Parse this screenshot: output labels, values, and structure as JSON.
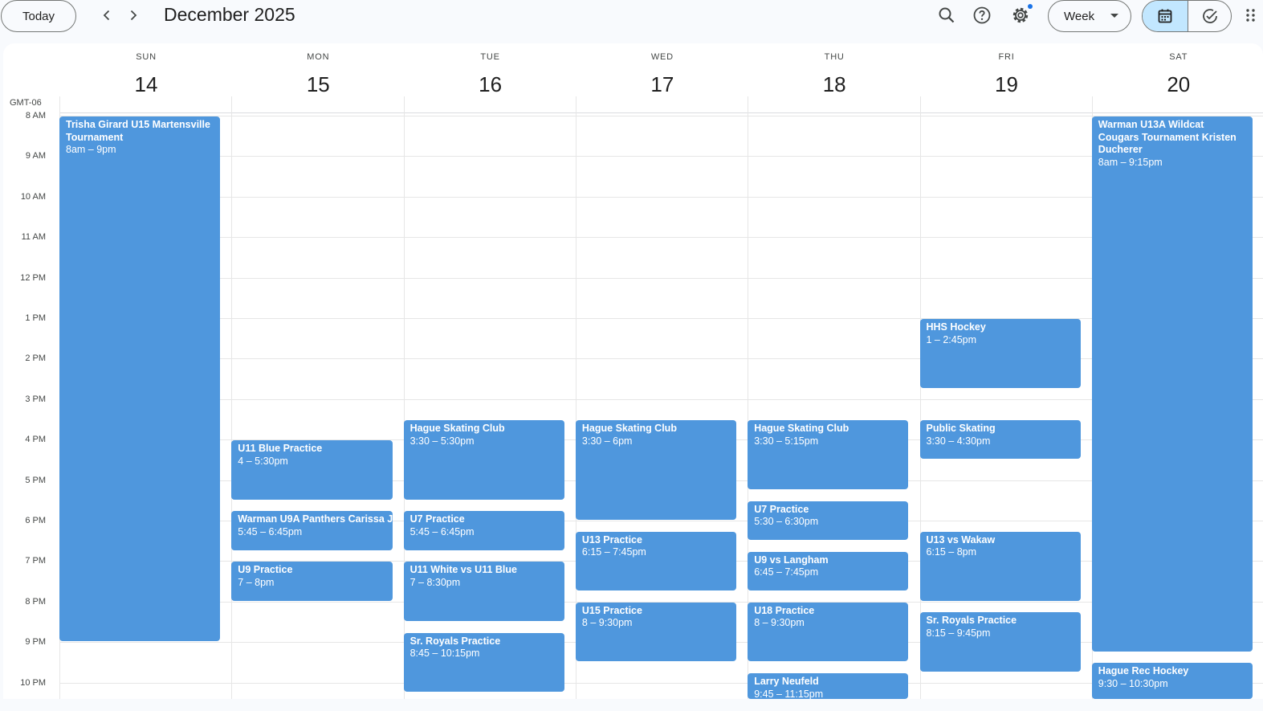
{
  "header": {
    "today_label": "Today",
    "month_title": "December 2025",
    "view_label": "Week",
    "icons": [
      "chevron-left-icon",
      "chevron-right-icon",
      "search-icon",
      "help-icon",
      "gear-icon",
      "calendar-icon",
      "tasks-icon",
      "apps-icon"
    ]
  },
  "grid": {
    "timezone": "GMT-06",
    "days": [
      {
        "dow": "SUN",
        "num": "14"
      },
      {
        "dow": "MON",
        "num": "15"
      },
      {
        "dow": "TUE",
        "num": "16"
      },
      {
        "dow": "WED",
        "num": "17"
      },
      {
        "dow": "THU",
        "num": "18"
      },
      {
        "dow": "FRI",
        "num": "19"
      },
      {
        "dow": "SAT",
        "num": "20"
      }
    ],
    "hours": [
      "8 AM",
      "9 AM",
      "10 AM",
      "11 AM",
      "12 PM",
      "1 PM",
      "2 PM",
      "3 PM",
      "4 PM",
      "5 PM",
      "6 PM",
      "7 PM",
      "8 PM",
      "9 PM",
      "10 PM"
    ]
  },
  "events": [
    {
      "day": 0,
      "start": 8.0,
      "end": 21.0,
      "title": "Trisha Girard U15 Martensville Tournament",
      "time": "8am – 9pm"
    },
    {
      "day": 1,
      "start": 16.0,
      "end": 17.5,
      "title": "U11 Blue Practice",
      "time": "4 – 5:30pm"
    },
    {
      "day": 1,
      "start": 17.75,
      "end": 18.75,
      "title": "Warman U9A Panthers Carissa J",
      "time": "5:45 – 6:45pm",
      "nowrap": true
    },
    {
      "day": 1,
      "start": 19.0,
      "end": 20.0,
      "title": "U9 Practice",
      "time": "7 – 8pm"
    },
    {
      "day": 2,
      "start": 15.5,
      "end": 17.5,
      "title": "Hague Skating Club",
      "time": "3:30 – 5:30pm"
    },
    {
      "day": 2,
      "start": 17.75,
      "end": 18.75,
      "title": "U7 Practice",
      "time": "5:45 – 6:45pm"
    },
    {
      "day": 2,
      "start": 19.0,
      "end": 20.5,
      "title": "U11 White vs U11 Blue",
      "time": "7 – 8:30pm"
    },
    {
      "day": 2,
      "start": 20.75,
      "end": 22.25,
      "title": "Sr. Royals Practice",
      "time": "8:45 – 10:15pm"
    },
    {
      "day": 3,
      "start": 15.5,
      "end": 18.0,
      "title": "Hague Skating Club",
      "time": "3:30 – 6pm"
    },
    {
      "day": 3,
      "start": 18.25,
      "end": 19.75,
      "title": "U13 Practice",
      "time": "6:15 – 7:45pm"
    },
    {
      "day": 3,
      "start": 20.0,
      "end": 21.5,
      "title": "U15 Practice",
      "time": "8 – 9:30pm"
    },
    {
      "day": 4,
      "start": 15.5,
      "end": 17.25,
      "title": "Hague Skating Club",
      "time": "3:30 – 5:15pm"
    },
    {
      "day": 4,
      "start": 17.5,
      "end": 18.5,
      "title": "U7 Practice",
      "time": "5:30 – 6:30pm"
    },
    {
      "day": 4,
      "start": 18.75,
      "end": 19.75,
      "title": "U9 vs Langham",
      "time": "6:45 – 7:45pm"
    },
    {
      "day": 4,
      "start": 20.0,
      "end": 21.5,
      "title": "U18 Practice",
      "time": "8 – 9:30pm"
    },
    {
      "day": 4,
      "start": 21.75,
      "end": 23.25,
      "title": "Larry Neufeld",
      "time": "9:45 – 11:15pm"
    },
    {
      "day": 5,
      "start": 13.0,
      "end": 14.75,
      "title": "HHS Hockey",
      "time": "1 – 2:45pm"
    },
    {
      "day": 5,
      "start": 15.5,
      "end": 16.5,
      "title": "Public Skating",
      "time": "3:30 – 4:30pm"
    },
    {
      "day": 5,
      "start": 18.25,
      "end": 20.0,
      "title": "U13 vs Wakaw",
      "time": "6:15 – 8pm"
    },
    {
      "day": 5,
      "start": 20.25,
      "end": 21.75,
      "title": "Sr. Royals Practice",
      "time": "8:15 – 9:45pm"
    },
    {
      "day": 6,
      "start": 8.0,
      "end": 21.25,
      "title": "Warman U13A Wildcat Cougars Tournament Kristen Ducherer",
      "time": "8am – 9:15pm"
    },
    {
      "day": 6,
      "start": 21.5,
      "end": 22.5,
      "title": "Hague Rec Hockey",
      "time": "9:30 – 10:30pm"
    }
  ]
}
